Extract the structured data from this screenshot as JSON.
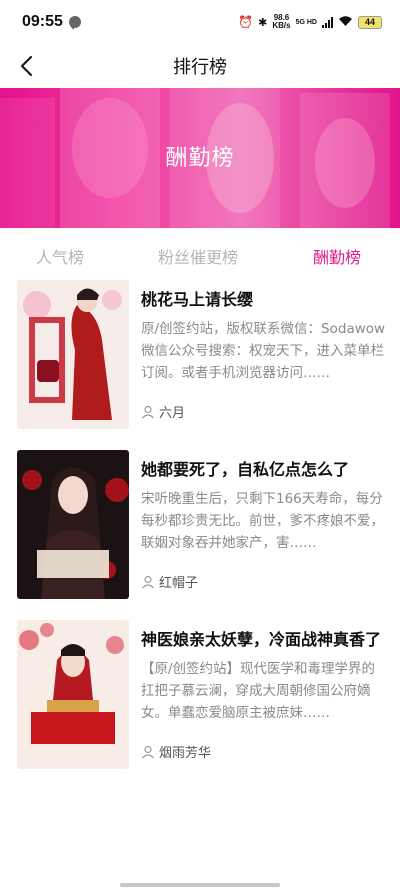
{
  "status_bar": {
    "time": "09:55",
    "speed_value": "98.6",
    "speed_unit": "KB/s",
    "net_label": "5G HD",
    "battery": "44"
  },
  "nav": {
    "title": "排行榜",
    "back_icon": "back-chevron-icon"
  },
  "banner": {
    "title": "酬勤榜"
  },
  "tabs": [
    {
      "label": "人气榜",
      "active": false
    },
    {
      "label": "粉丝催更榜",
      "active": false
    },
    {
      "label": "酬勤榜",
      "active": true
    }
  ],
  "books": [
    {
      "title": "桃花马上请长缨",
      "description": "原/创签约站，版权联系微信：Sodawow微信公众号搜索：权宠天下，进入菜单栏订阅。或者手机浏览器访问……",
      "author": "六月"
    },
    {
      "title": "她都要死了，自私亿点怎么了",
      "description": "宋听晚重生后，只剩下166天寿命，每分每秒都珍贵无比。前世，爹不疼娘不爱，联姻对象吞并她家产，害……",
      "author": "红帽子"
    },
    {
      "title": "神医娘亲太妖孽，冷面战神真香了",
      "description": "【原/创签约站】现代医学和毒理学界的扛把子慕云澜，穿成大周朝修国公府嫡女。单蠢恋爱脑原主被庶妹……",
      "author": "烟雨芳华"
    }
  ],
  "colors": {
    "accent": "#e0218a",
    "banner": "#ec3a9c",
    "muted": "#b5b5b5"
  }
}
